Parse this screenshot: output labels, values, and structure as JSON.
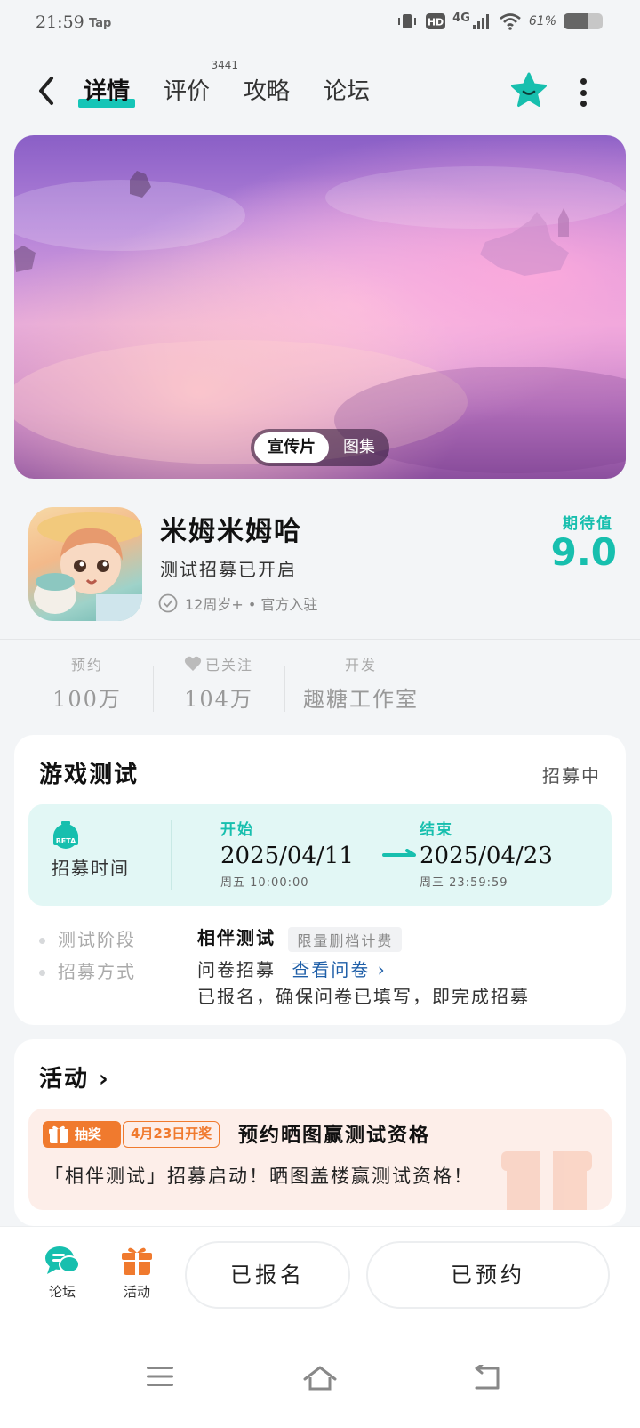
{
  "status_bar": {
    "time": "21:59",
    "carrier_badge": "Tap",
    "network": "4G",
    "battery": "61%",
    "battery_level": 0.61
  },
  "nav": {
    "tabs": [
      {
        "label": "详情",
        "active": true
      },
      {
        "label": "评价",
        "count": "3441"
      },
      {
        "label": "攻略"
      },
      {
        "label": "论坛"
      }
    ]
  },
  "hero": {
    "seg_active": "宣传片",
    "seg_other": "图集"
  },
  "app": {
    "name": "米姆米姆哈",
    "subtitle": "测试招募已开启",
    "tags": "12周岁+ • 官方入驻",
    "expect_label": "期待值",
    "expect_score": "9.0"
  },
  "stats": [
    {
      "label": "预约",
      "value": "100万"
    },
    {
      "label": "已关注",
      "value": "104万"
    },
    {
      "label": "开发",
      "value": "趣糖工作室"
    }
  ],
  "test_card": {
    "title": "游戏测试",
    "status": "招募中",
    "beta_icon_text": "BETA",
    "recruit_label": "招募时间",
    "start": {
      "key": "开始",
      "date": "2025/04/11",
      "weekday_time": "周五  10:00:00"
    },
    "end": {
      "key": "结束",
      "date": "2025/04/23",
      "weekday_time": "周三  23:59:59"
    },
    "phase_label": "测试阶段",
    "phase_value": "相伴测试",
    "phase_pill": "限量删档计费",
    "method_label": "招募方式",
    "method_value": "问卷招募",
    "method_link": "查看问卷 ›",
    "method_note": "已报名，确保问卷已填写，即完成招募"
  },
  "activity_card": {
    "title": "活动 ›",
    "badge": "抽奖",
    "date_badge": "4月23日开奖",
    "headline": "预约晒图赢测试资格",
    "desc": "「相伴测试」招募启动！晒图盖楼赢测试资格！"
  },
  "bottom": {
    "forum": "论坛",
    "activity": "活动",
    "signed_up": "已报名",
    "reserved": "已预约"
  },
  "colors": {
    "accent": "#17bfae",
    "orange": "#f07a2e",
    "link": "#1f5fa8"
  }
}
